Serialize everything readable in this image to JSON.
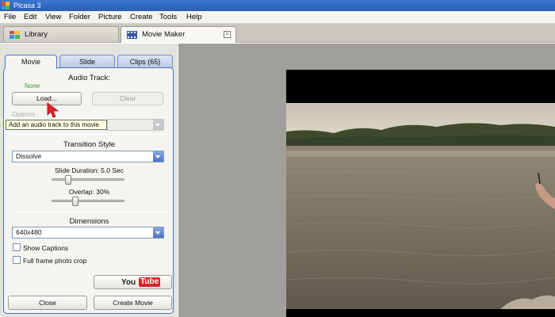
{
  "window": {
    "title": "Picasa 3"
  },
  "menu": [
    "File",
    "Edit",
    "View",
    "Folder",
    "Picture",
    "Create",
    "Tools",
    "Help"
  ],
  "tabs": {
    "library": "Library",
    "movie_maker": "Movie Maker",
    "close_glyph": "×"
  },
  "panel_tabs": {
    "movie": "Movie",
    "slide": "Slide",
    "clips": "Clips (65)"
  },
  "audio": {
    "section_title": "Audio Track:",
    "status": "None",
    "load_label": "Load...",
    "clear_label": "Clear",
    "options_label": "Options",
    "tooltip": "Add an audio track to this movie"
  },
  "transition": {
    "section_title": "Transition Style",
    "selected": "Dissolve",
    "slide_duration_label": "Slide Duration: 5.0 Sec",
    "slide_duration_level": 0.3,
    "overlap_label": "Overlap: 30%",
    "overlap_level": 0.3
  },
  "dimensions": {
    "section_title": "Dimensions",
    "selected": "640x480",
    "show_captions_label": "Show Captions",
    "show_captions": false,
    "full_frame_label": "Full frame photo crop",
    "full_frame": false
  },
  "actions": {
    "youtube_you": "You",
    "youtube_tube": "Tube",
    "close_label": "Close",
    "create_movie_label": "Create Movie"
  },
  "colors": {
    "titlebar": "#2f64c0",
    "status_green": "#3a9c2a",
    "panel_border": "#4a78c6",
    "youtube_red": "#d6262b"
  }
}
